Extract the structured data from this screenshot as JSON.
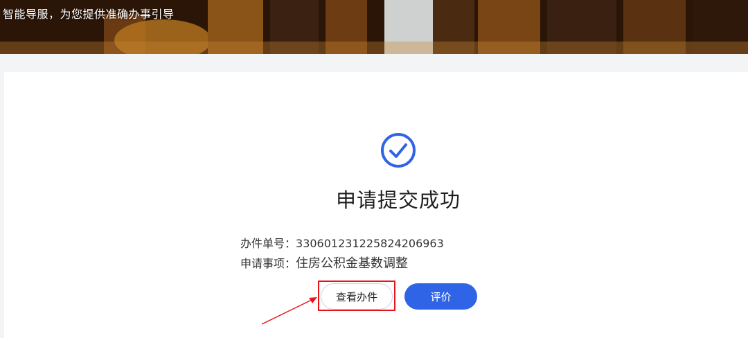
{
  "banner": {
    "text": "智能导服，为您提供准确办事引导"
  },
  "result": {
    "title": "申请提交成功",
    "case_number_label": "办件单号：",
    "case_number_value": "33060123122582420696З",
    "item_label": "申请事项：",
    "item_value": "住房公积金基数调整"
  },
  "actions": {
    "view_label": "查看办件",
    "rate_label": "评价"
  },
  "colors": {
    "accent": "#2f64e6",
    "highlight": "#e8141c",
    "success": "#2f64e6"
  }
}
